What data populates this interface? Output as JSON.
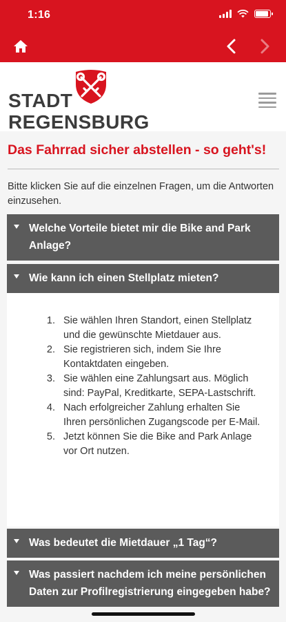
{
  "status_bar": {
    "time": "1:16"
  },
  "navbar": {
    "home_icon": "home-icon",
    "back_icon": "chevron-left-icon",
    "forward_icon": "chevron-right-icon"
  },
  "header": {
    "logo_line1": "STADT",
    "logo_line2": "REGENSBURG",
    "crest_icon": "crossed-keys-crest-icon",
    "menu_icon": "hamburger-menu-icon"
  },
  "page": {
    "title": "Das Fahrrad sicher abstellen - so geht's!",
    "intro": "Bitte klicken Sie auf die einzelnen Fragen, um die Antworten einzusehen."
  },
  "faq": [
    {
      "question": "Welche Vorteile bietet mir die Bike and Park Anlage?",
      "expanded": false
    },
    {
      "question": "Wie kann ich einen Stellplatz mieten?",
      "expanded": true,
      "answer_steps": [
        "Sie wählen Ihren Standort, einen Stellplatz und die gewünschte Mietdauer aus.",
        "Sie registrieren sich, indem Sie Ihre Kontaktdaten eingeben.",
        "Sie wählen eine Zahlungsart aus. Möglich sind: PayPal, Kreditkarte, SEPA-Lastschrift.",
        "Nach erfolgreicher Zahlung erhalten Sie Ihren persönlichen Zugangscode per E-Mail.",
        "Jetzt können Sie die Bike and Park Anlage vor Ort nutzen."
      ]
    },
    {
      "question": "Was bedeutet die Mietdauer „1 Tag“?",
      "expanded": false
    },
    {
      "question": "Was passiert nachdem ich meine persönlichen Daten zur Profilregistrierung eingegeben habe?",
      "expanded": false
    }
  ],
  "colors": {
    "brand_red": "#d8141f",
    "accordion_gray": "#5b5b5b",
    "background": "#f5f5f5"
  }
}
